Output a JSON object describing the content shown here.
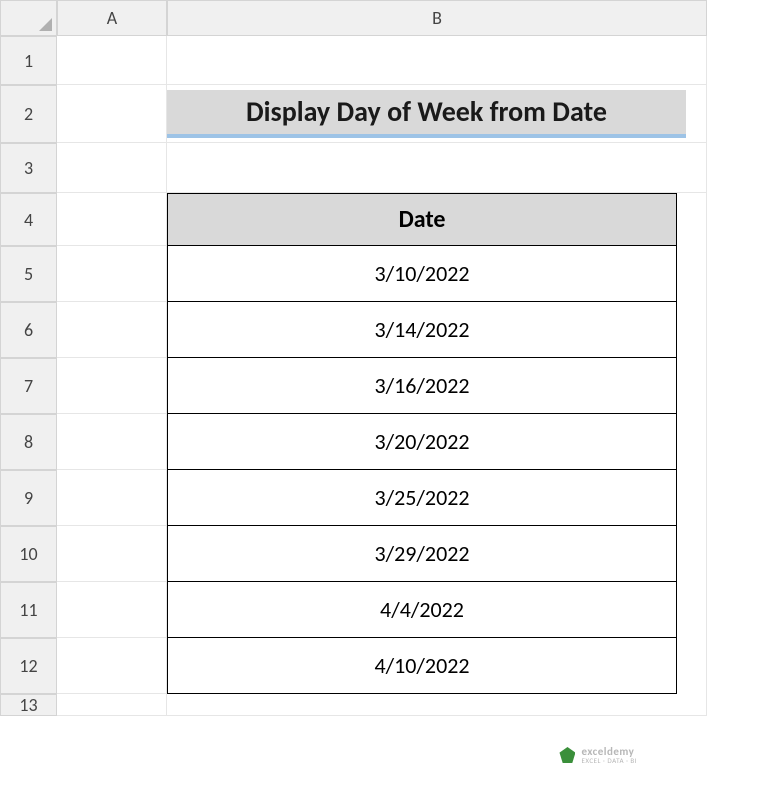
{
  "columns": [
    "A",
    "B"
  ],
  "rowNumbers": [
    1,
    2,
    3,
    4,
    5,
    6,
    7,
    8,
    9,
    10,
    11,
    12,
    13
  ],
  "title": "Display Day of Week from Date",
  "table": {
    "header": "Date",
    "rows": [
      "3/10/2022",
      "3/14/2022",
      "3/16/2022",
      "3/20/2022",
      "3/25/2022",
      "3/29/2022",
      "4/4/2022",
      "4/10/2022"
    ]
  },
  "watermark": {
    "main": "exceldemy",
    "sub": "EXCEL · DATA · BI"
  }
}
